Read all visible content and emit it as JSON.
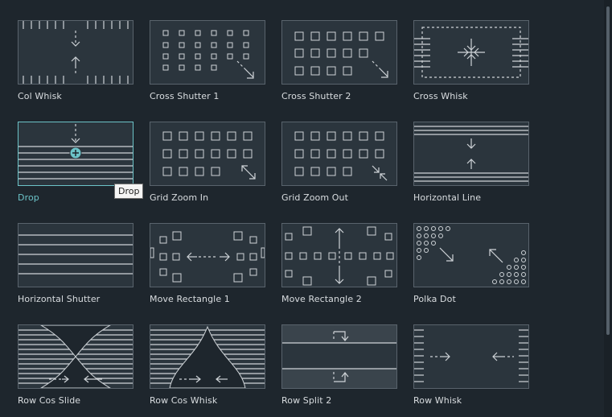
{
  "transitions": [
    {
      "label": "Col Whisk",
      "icon": "col-whisk-icon"
    },
    {
      "label": "Cross Shutter 1",
      "icon": "cross-shutter-1-icon"
    },
    {
      "label": "Cross Shutter 2",
      "icon": "cross-shutter-2-icon"
    },
    {
      "label": "Cross Whisk",
      "icon": "cross-whisk-icon"
    },
    {
      "label": "Drop",
      "icon": "drop-icon",
      "selected": true
    },
    {
      "label": "Grid Zoom In",
      "icon": "grid-zoom-in-icon"
    },
    {
      "label": "Grid Zoom Out",
      "icon": "grid-zoom-out-icon"
    },
    {
      "label": "Horizontal Line",
      "icon": "horizontal-line-icon"
    },
    {
      "label": "Horizontal Shutter",
      "icon": "horizontal-shutter-icon"
    },
    {
      "label": "Move Rectangle 1",
      "icon": "move-rectangle-1-icon"
    },
    {
      "label": "Move Rectangle 2",
      "icon": "move-rectangle-2-icon"
    },
    {
      "label": "Polka Dot",
      "icon": "polka-dot-icon"
    },
    {
      "label": "Row Cos Slide",
      "icon": "row-cos-slide-icon"
    },
    {
      "label": "Row Cos Whisk",
      "icon": "row-cos-whisk-icon"
    },
    {
      "label": "Row Split 2",
      "icon": "row-split-2-icon"
    },
    {
      "label": "Row Whisk",
      "icon": "row-whisk-icon"
    }
  ],
  "tooltip": {
    "text": "Drop"
  },
  "colors": {
    "accent": "#6cc3c8",
    "background": "#1e262d",
    "thumb_bg": "#2b353d"
  }
}
